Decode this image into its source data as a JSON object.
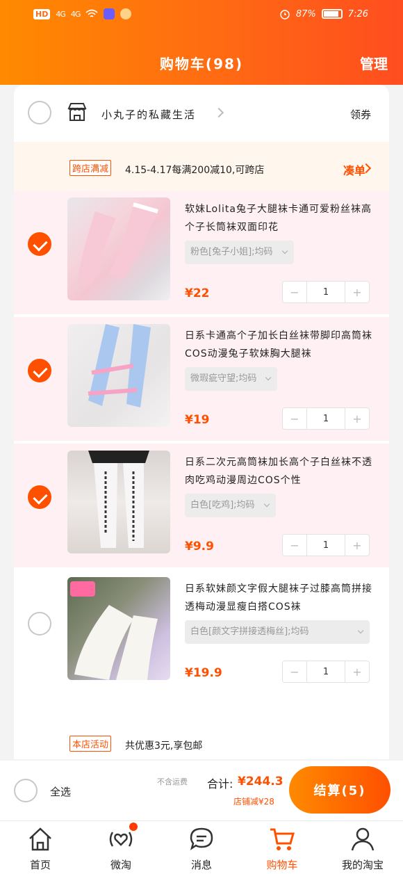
{
  "status_bar": {
    "hd": "HD",
    "signal1": "4G",
    "signal2": "4G",
    "battery": "87%",
    "time": "7:26"
  },
  "header": {
    "title": "购物车(98)",
    "manage": "管理"
  },
  "shop": {
    "name": "小丸子的私藏生活",
    "coupon": "领券"
  },
  "promo": {
    "tag": "跨店满减",
    "text": "4.15-4.17每满200减10,可跨店",
    "link": "凑单"
  },
  "items": [
    {
      "name": "软妹Lolita兔子大腿袜卡通可爱粉丝袜高个子长筒袜双面印花",
      "sku": "粉色[兔子小姐];均码",
      "price": "¥22",
      "qty": "1",
      "selected": true
    },
    {
      "name": "日系卡通高个子加长白丝袜带脚印高筒袜COS动漫兔子软妹胸大腿袜",
      "sku": "微瑕疵守望;均码",
      "price": "¥19",
      "qty": "1",
      "selected": true
    },
    {
      "name": "日系二次元高筒袜加长高个子白丝袜不透肉吃鸡动漫周边COS个性",
      "sku": "白色[吃鸡];均码",
      "price": "¥9.9",
      "qty": "1",
      "selected": true
    },
    {
      "name": "日系软妹颜文字假大腿袜子过膝高筒拼接透梅动漫显瘦白搭COS袜",
      "sku": "白色[颜文字拼接透梅丝];均码",
      "price": "¥19.9",
      "qty": "1",
      "selected": false
    }
  ],
  "store_activity": {
    "tag": "本店活动",
    "text": "共优惠3元,享包邮"
  },
  "summary": {
    "select_all": "全选",
    "free_ship": "不含运费",
    "total_label": "合计:",
    "total": "¥244.3",
    "discount": "店铺减¥28",
    "checkout": "结算(5)"
  },
  "tabs": [
    {
      "label": "首页",
      "icon": "home-icon"
    },
    {
      "label": "微淘",
      "icon": "weitao-icon"
    },
    {
      "label": "消息",
      "icon": "message-icon"
    },
    {
      "label": "购物车",
      "icon": "cart-icon"
    },
    {
      "label": "我的淘宝",
      "icon": "profile-icon"
    }
  ],
  "colors": {
    "brand": "#ff5000",
    "header_start": "#ff8a00",
    "selected_row": "#fff1f3"
  }
}
